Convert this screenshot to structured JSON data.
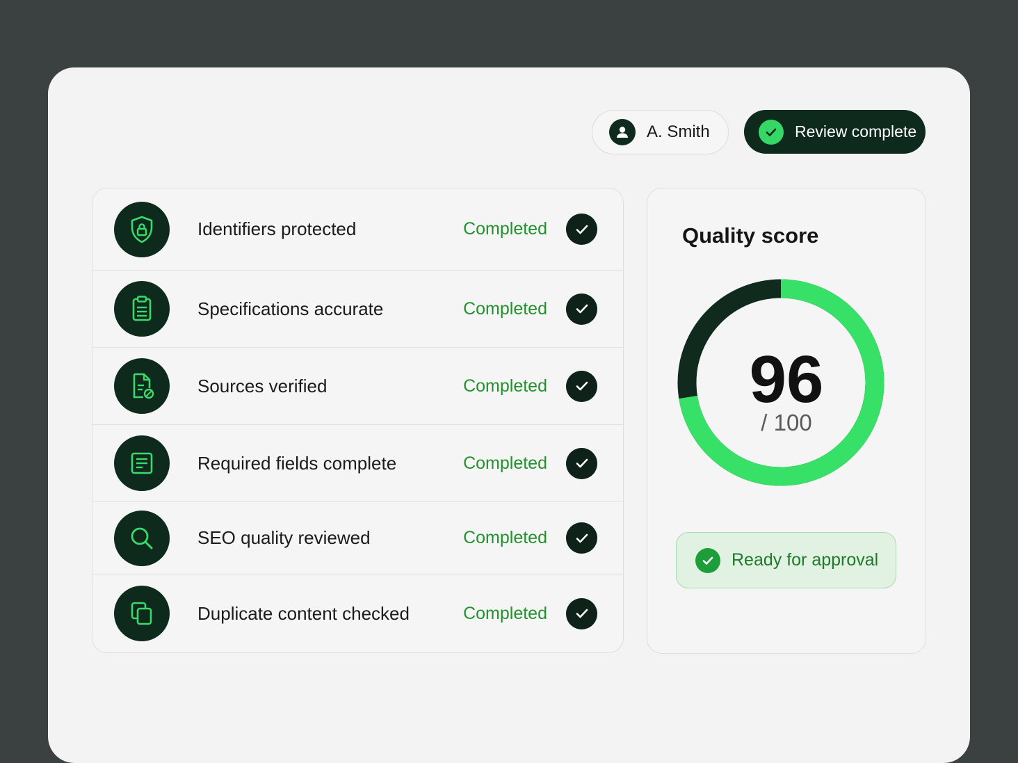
{
  "header": {
    "user_name": "A. Smith",
    "status_label": "Review complete"
  },
  "checklist": {
    "items": [
      {
        "label": "Identifiers protected",
        "status": "Completed",
        "icon": "shield-lock-icon"
      },
      {
        "label": "Specifications accurate",
        "status": "Completed",
        "icon": "clipboard-icon"
      },
      {
        "label": "Sources verified",
        "status": "Completed",
        "icon": "document-verified-icon"
      },
      {
        "label": "Required fields complete",
        "status": "Completed",
        "icon": "form-fields-icon"
      },
      {
        "label": "SEO quality reviewed",
        "status": "Completed",
        "icon": "search-icon"
      },
      {
        "label": "Duplicate content checked",
        "status": "Completed",
        "icon": "copy-icon"
      }
    ]
  },
  "score": {
    "title": "Quality score",
    "value": "96",
    "max_label": "/ 100",
    "value_fraction": 0.96,
    "approval_label": "Ready for approval"
  },
  "colors": {
    "accent_green": "#35d866",
    "dark_green": "#0e2a1d",
    "status_text": "#22912e",
    "background": "#3b4040"
  }
}
